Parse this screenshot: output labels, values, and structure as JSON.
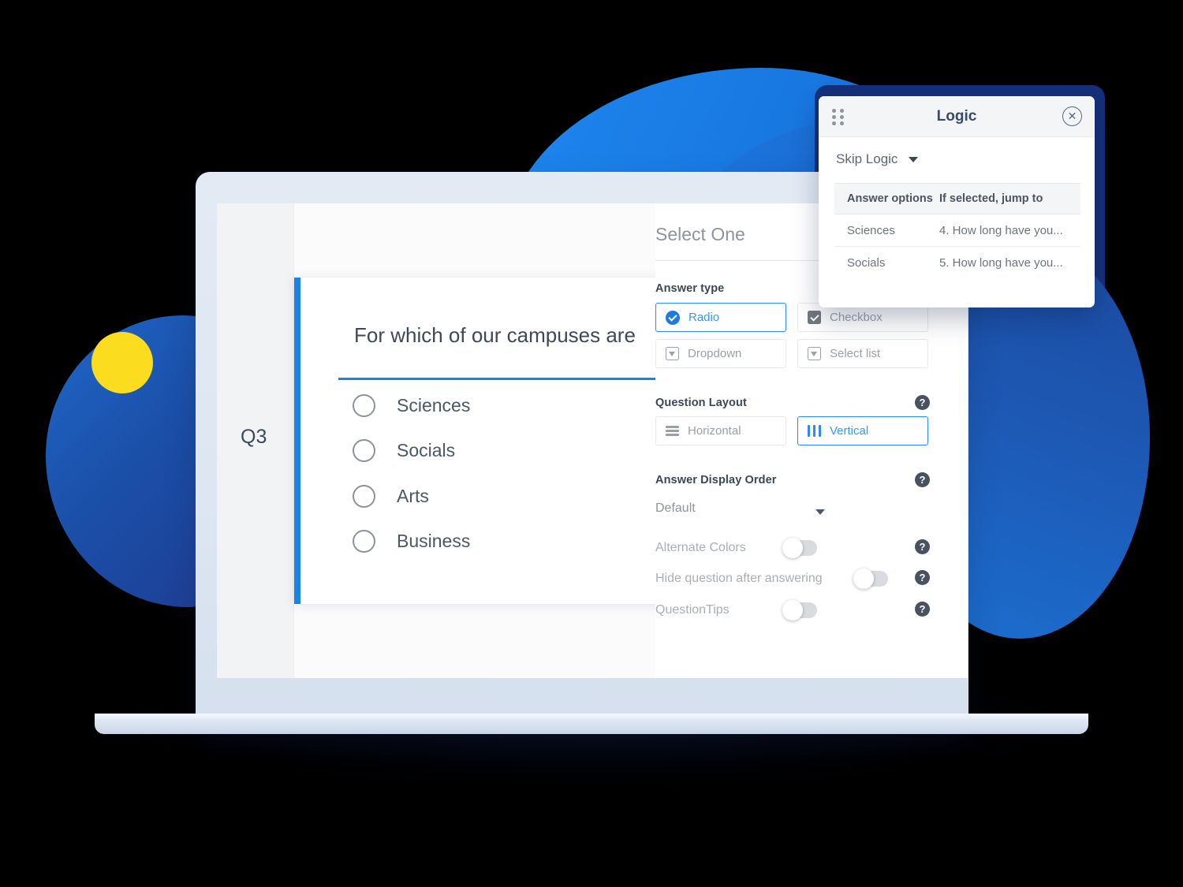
{
  "background": {
    "accent_blue": "#1a84e2",
    "deep_blue": "#1e3a8f",
    "navy": "#15307a",
    "yellow": "#FCDC1E"
  },
  "screen": {
    "question_number": "Q3",
    "question_card": {
      "title": "For which of our campuses are",
      "options": [
        "Sciences",
        "Socials",
        "Arts",
        "Business"
      ]
    }
  },
  "settings_panel": {
    "title": "Select One",
    "answer_type": {
      "heading": "Answer type",
      "options": [
        {
          "label": "Radio",
          "icon": "radio-checked-icon",
          "selected": true
        },
        {
          "label": "Checkbox",
          "icon": "checkbox-checked-icon",
          "selected": false
        },
        {
          "label": "Dropdown",
          "icon": "dropdown-icon",
          "selected": false
        },
        {
          "label": "Select list",
          "icon": "select-list-icon",
          "selected": false
        }
      ]
    },
    "question_layout": {
      "heading": "Question Layout",
      "help": "?",
      "options": [
        {
          "label": "Horizontal",
          "icon": "horizontal-lines-icon",
          "selected": false
        },
        {
          "label": "Vertical",
          "icon": "vertical-bars-icon",
          "selected": true
        }
      ]
    },
    "answer_display_order": {
      "heading": "Answer Display Order",
      "help": "?",
      "selected": "Default"
    },
    "toggles": [
      {
        "label": "Alternate Colors",
        "on": false,
        "help": "?"
      },
      {
        "label": "Hide question after answering",
        "on": false,
        "help": "?"
      },
      {
        "label": "QuestionTips",
        "on": false,
        "help": "?"
      }
    ]
  },
  "logic_popup": {
    "title": "Logic",
    "close_icon": "close-circle-icon",
    "drag_icon": "drag-handle-icon",
    "mode_selector": "Skip Logic",
    "table": {
      "headers": [
        "Answer options",
        "If selected, jump to"
      ],
      "rows": [
        {
          "option": "Sciences",
          "jump_to": "4. How long have you..."
        },
        {
          "option": "Socials",
          "jump_to": "5. How long have you..."
        }
      ]
    }
  }
}
